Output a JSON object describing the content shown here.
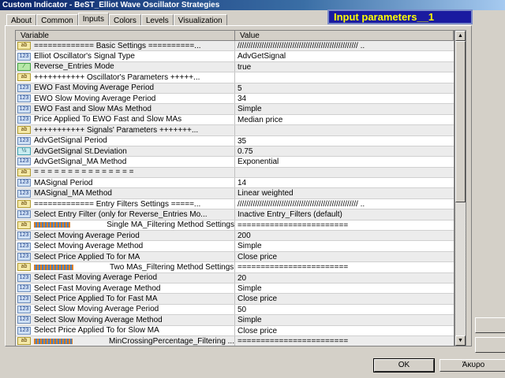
{
  "window": {
    "title": "Custom Indicator - BeST_Elliot Wave Oscillator Strategies"
  },
  "badge": "Input parameters__1",
  "tabs": [
    "About",
    "Common",
    "Inputs",
    "Colors",
    "Levels",
    "Visualization"
  ],
  "active_tab": "Inputs",
  "columns": {
    "variable": "Variable",
    "value": "Value"
  },
  "rows": [
    {
      "icon": "ab",
      "variable": "============= Basic Settings ==========...",
      "value": "/////////////////////////////////////////////////////// .."
    },
    {
      "icon": "123",
      "variable": "Elliot Oscillator's Signal Type",
      "value": "AdvGetSignal"
    },
    {
      "icon": "bool",
      "variable": "Reverse_Entries Mode",
      "value": "true"
    },
    {
      "icon": "ab",
      "variable": "+++++++++++   Oscillator's Parameters   +++++...",
      "value": ""
    },
    {
      "icon": "123",
      "variable": "EWO Fast Moving Average Period",
      "value": "5"
    },
    {
      "icon": "123",
      "variable": "EWO Slow Moving Average Period",
      "value": "34"
    },
    {
      "icon": "123",
      "variable": "EWO Fast and Slow MAs Method",
      "value": "Simple"
    },
    {
      "icon": "123",
      "variable": "Price Applied To EWO Fast and Slow MAs",
      "value": "Median price"
    },
    {
      "icon": "ab",
      "variable": "+++++++++++   Signals' Parameters   +++++++...",
      "value": ""
    },
    {
      "icon": "123",
      "variable": "AdvGetSignal Period",
      "value": "35"
    },
    {
      "icon": "dbl",
      "variable": "AdvGetSignal St.Deviation",
      "value": "0.75"
    },
    {
      "icon": "123",
      "variable": "AdvGetSignal_MA Method",
      "value": "Exponential"
    },
    {
      "icon": "ab",
      "variable": "= = = = = = = = = = = = = = =",
      "value": ""
    },
    {
      "icon": "123",
      "variable": "MASignal Period",
      "value": "14"
    },
    {
      "icon": "123",
      "variable": "MASignal_MA Method",
      "value": "Linear weighted"
    },
    {
      "icon": "ab",
      "variable": "============= Entry Filters Settings =====...",
      "value": "/////////////////////////////////////////////////////// .."
    },
    {
      "icon": "123",
      "variable": "Select Entry Filter (only for Reverse_Entries Mo...",
      "value": "Inactive Entry_Filters (default)"
    },
    {
      "icon": "ab",
      "bar": true,
      "variable": "Single MA_Filtering Method Settings",
      "value": "========================"
    },
    {
      "icon": "123",
      "variable": "Select Moving Average Period",
      "value": "200"
    },
    {
      "icon": "123",
      "variable": "Select Moving Average Method",
      "value": "Simple"
    },
    {
      "icon": "123",
      "variable": "Select Price Applied To for MA",
      "value": "Close price"
    },
    {
      "icon": "ab",
      "bar": true,
      "variable": "Two MAs_Filtering Method Settings",
      "value": "========================"
    },
    {
      "icon": "123",
      "variable": "Select Fast Moving Average Period",
      "value": "20"
    },
    {
      "icon": "123",
      "variable": "Select Fast Moving Average Method",
      "value": "Simple"
    },
    {
      "icon": "123",
      "variable": "Select Price Applied To for Fast MA",
      "value": "Close price"
    },
    {
      "icon": "123",
      "variable": "Select Slow Moving Average Period",
      "value": "50"
    },
    {
      "icon": "123",
      "variable": "Select Slow Moving Average Method",
      "value": "Simple"
    },
    {
      "icon": "123",
      "variable": "Select Price Applied To for Slow MA",
      "value": "Close price"
    },
    {
      "icon": "ab",
      "bar": true,
      "variable": "MinCrossingPercentage_Filtering ...",
      "value": "========================"
    }
  ],
  "icon_labels": {
    "ab": "ab",
    "123": "123",
    "bool": "⁄",
    "dbl": "½"
  },
  "buttons": {
    "ok": "OK",
    "cancel": "Άκυρο"
  }
}
